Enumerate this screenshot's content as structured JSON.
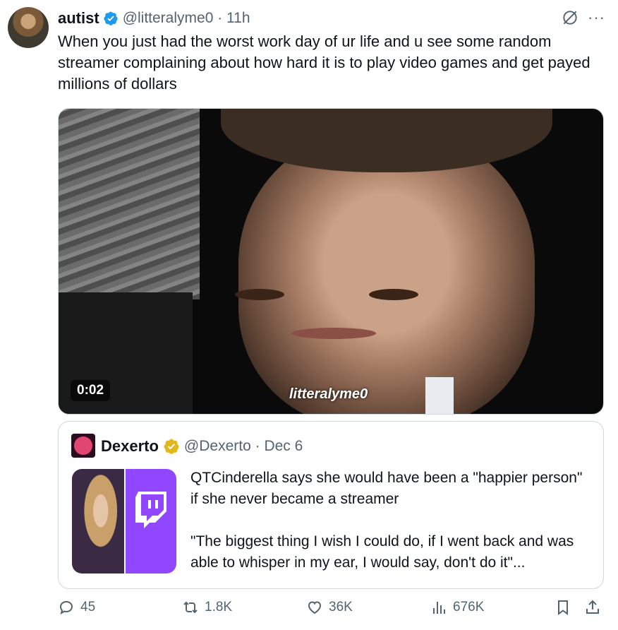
{
  "author": {
    "name": "autist",
    "handle": "@litteralyme0",
    "time": "11h",
    "verified_icon": "blue-verified-badge"
  },
  "tweet": {
    "text": "When you just had the worst work day of ur life and u see some random streamer complaining about how hard it is to play video games and get payed millions of dollars"
  },
  "media": {
    "duration": "0:02",
    "watermark": "litteralyme0"
  },
  "quote": {
    "name": "Dexerto",
    "handle": "@Dexerto",
    "date": "Dec 6",
    "badge_icon": "gold-verified-badge",
    "paragraph_1": "QTCinderella says she would have been a \"happier person\" if she never became a streamer",
    "paragraph_2": "\"The biggest thing I wish I could do, if I went back and was able to whisper in my ear, I would say, don't do it\"..."
  },
  "actions": {
    "replies": "45",
    "reposts": "1.8K",
    "likes": "36K",
    "views": "676K"
  },
  "colors": {
    "text": "#0f1419",
    "secondary": "#536471",
    "verified_blue": "#1d9bf0",
    "verified_gold": "#e2b719",
    "twitch_purple": "#9146ff"
  }
}
